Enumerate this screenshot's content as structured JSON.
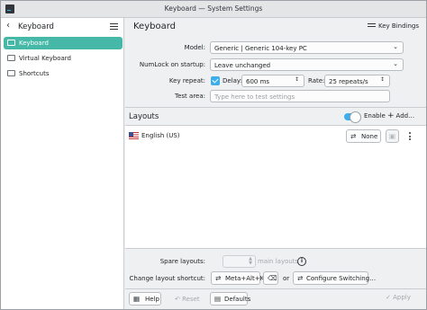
{
  "window": {
    "title": "Keyboard — System Settings"
  },
  "sidebar": {
    "title": "Keyboard",
    "items": [
      {
        "label": "Keyboard",
        "icon": "keyboard-icon",
        "active": true
      },
      {
        "label": "Virtual Keyboard",
        "icon": "virtual-keyboard-icon",
        "active": false
      },
      {
        "label": "Shortcuts",
        "icon": "shortcuts-icon",
        "active": false
      }
    ]
  },
  "header": {
    "title": "Keyboard",
    "key_bindings_label": "Key Bindings"
  },
  "form": {
    "model_label": "Model:",
    "model_value": "Generic | Generic 104-key PC",
    "numlock_label": "NumLock on startup:",
    "numlock_value": "Leave unchanged",
    "key_repeat_label": "Key repeat:",
    "key_repeat_checked": true,
    "delay_label": "Delay:",
    "delay_value": "600 ms",
    "rate_label": "Rate:",
    "rate_value": "25 repeats/s",
    "test_area_label": "Test area:",
    "test_area_placeholder": "Type here to test settings"
  },
  "layouts": {
    "title": "Layouts",
    "enable_label": "Enable",
    "enabled": true,
    "add_label": "Add…",
    "rows": [
      {
        "name": "English (US)",
        "shortcut": "None",
        "flag": "us-flag-icon"
      }
    ]
  },
  "bottom": {
    "spare_label": "Spare layouts:",
    "spare_suffix": "main layouts",
    "change_shortcut_label": "Change layout shortcut:",
    "shortcut_value": "Meta+Alt+K",
    "or_label": "or",
    "configure_label": "Configure Switching…"
  },
  "footer": {
    "help_label": "Help",
    "reset_label": "Reset",
    "defaults_label": "Defaults",
    "apply_label": "Apply"
  },
  "colors": {
    "accent": "#3daee9",
    "selection": "#45b8a7"
  }
}
